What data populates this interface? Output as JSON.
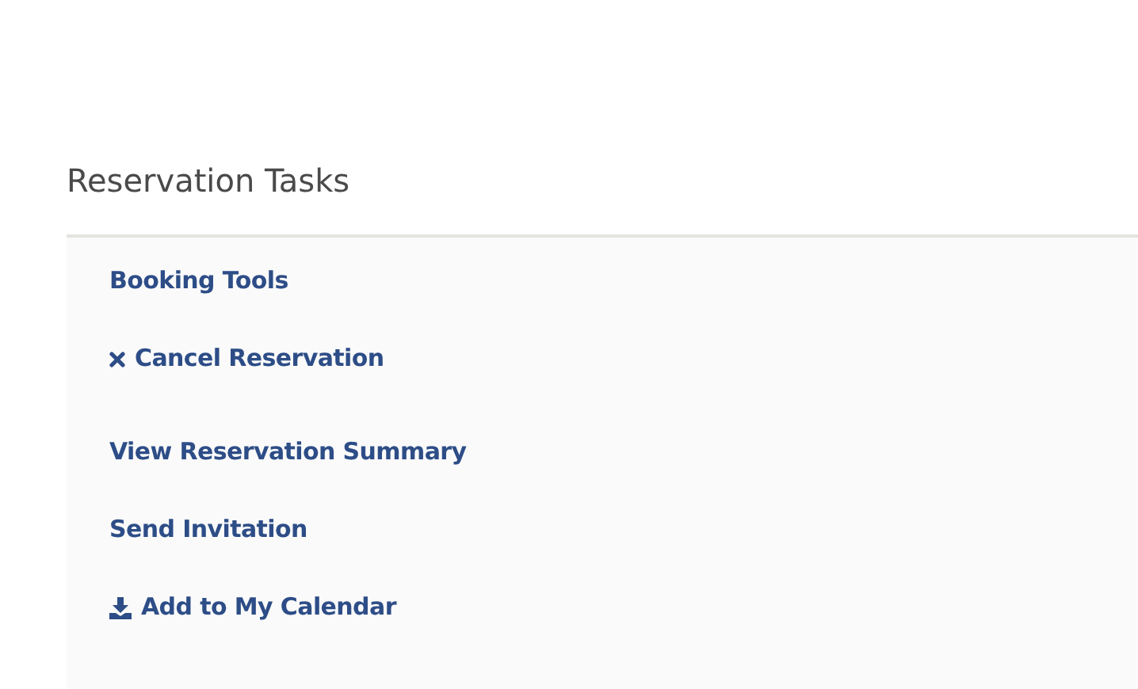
{
  "section": {
    "title": "Reservation Tasks"
  },
  "groups": [
    {
      "links": [
        {
          "label": "Booking Tools",
          "kind": "plain"
        },
        {
          "label": "Cancel Reservation",
          "kind": "cancel"
        }
      ]
    },
    {
      "links": [
        {
          "label": "View Reservation Summary",
          "kind": "plain"
        },
        {
          "label": "Send Invitation",
          "kind": "plain"
        },
        {
          "label": "Add to My Calendar",
          "kind": "download"
        }
      ]
    }
  ]
}
